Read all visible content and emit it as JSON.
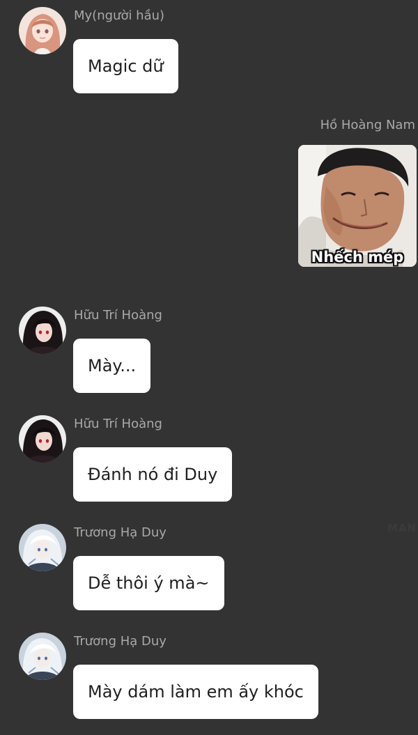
{
  "messages": [
    {
      "sender": "My(người hầu)",
      "text": "Magic dữ",
      "avatar": "anime-girl-pink-hair-avatar"
    },
    {
      "sender": "Hữu Trí Hoàng",
      "text": "Mày...",
      "avatar": "anime-boy-dark-hair-avatar"
    },
    {
      "sender": "Hữu Trí Hoàng",
      "text": "Đánh nó đi Duy",
      "avatar": "anime-boy-dark-hair-avatar"
    },
    {
      "sender": "Trương Hạ Duy",
      "text": "Dễ thôi ý mà~",
      "avatar": "anime-boy-white-hair-avatar"
    },
    {
      "sender": "Trương Hạ Duy",
      "text": "Mày dám làm em ấy khóc",
      "avatar": "anime-boy-white-hair-avatar"
    }
  ],
  "sticker_message": {
    "sender": "Hồ Hoàng Nam",
    "caption": "Nhếch mép",
    "image": "smirking-boy-meme-sticker"
  },
  "watermark": "MAN",
  "colors": {
    "background": "#333333",
    "bubble": "#ffffff",
    "sender_text": "#a9a9a9",
    "message_text": "#1f1f1f"
  }
}
